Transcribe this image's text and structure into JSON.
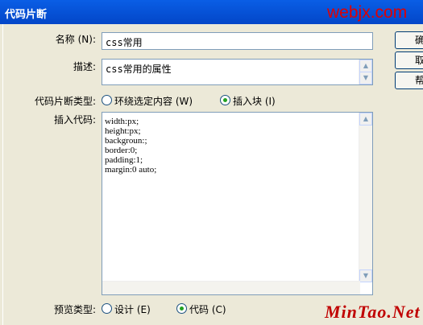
{
  "dialog": {
    "title": "代码片断",
    "watermark": "webjx.com",
    "brand_watermark": "MinTao.Net"
  },
  "form": {
    "name_label": "名称 (N):",
    "name_value": "css常用",
    "desc_label": "描述:",
    "desc_value": "css常用的属性",
    "type_label": "代码片断类型:",
    "type_options": [
      {
        "label": "环绕选定内容 (W)",
        "selected": false
      },
      {
        "label": "插入块 (I)",
        "selected": true
      }
    ],
    "code_label": "插入代码:",
    "code_lines": [
      "width:px;",
      "height:px;",
      "backgroun:;",
      "border:0;",
      "padding:1;",
      "margin:0 auto;"
    ],
    "preview_label": "预览类型:",
    "preview_options": [
      {
        "label": "设计 (E)",
        "selected": false
      },
      {
        "label": "代码 (C)",
        "selected": true
      }
    ]
  },
  "buttons": {
    "ok": "确",
    "cancel": "取",
    "help": "帮"
  },
  "icons": {
    "scroll_up": "scroll-up-icon",
    "scroll_down": "scroll-down-icon"
  }
}
